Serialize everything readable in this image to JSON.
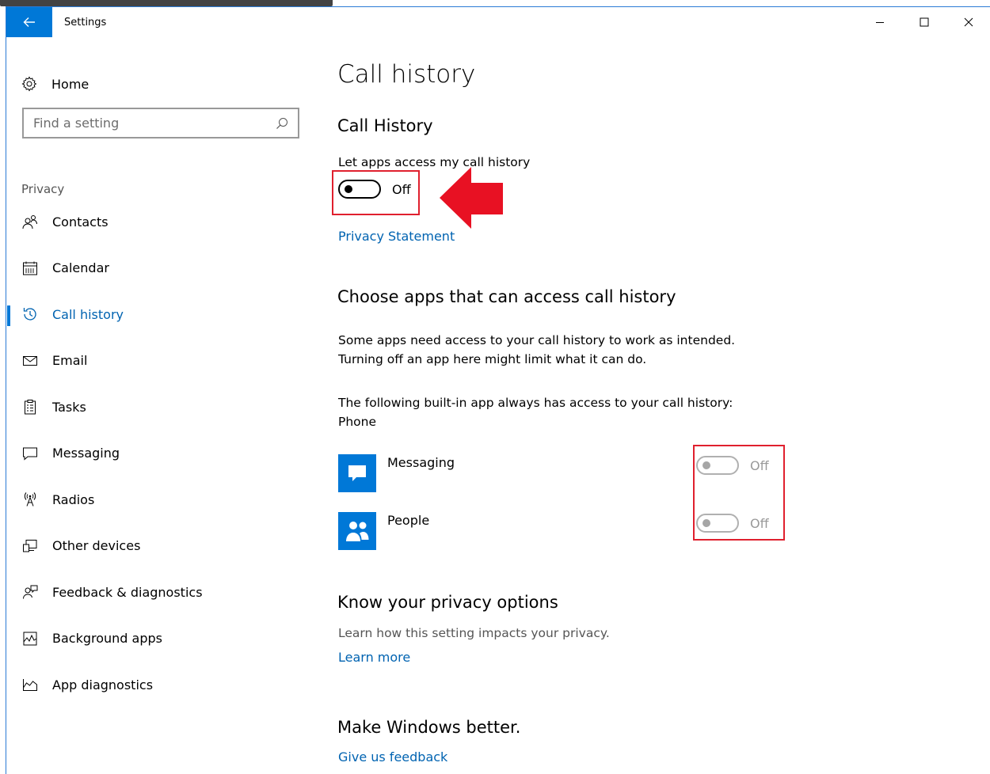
{
  "window": {
    "title": "Settings",
    "accent": "#0078d7",
    "controls": [
      "minimize-icon",
      "maximize-icon",
      "close-icon"
    ]
  },
  "sidebar": {
    "home_label": "Home",
    "search_placeholder": "Find a setting",
    "section_label": "Privacy",
    "items": [
      {
        "label": "Contacts",
        "icon": "contacts-icon"
      },
      {
        "label": "Calendar",
        "icon": "calendar-icon"
      },
      {
        "label": "Call history",
        "icon": "history-icon",
        "active": true
      },
      {
        "label": "Email",
        "icon": "email-icon"
      },
      {
        "label": "Tasks",
        "icon": "tasks-icon"
      },
      {
        "label": "Messaging",
        "icon": "messaging-icon"
      },
      {
        "label": "Radios",
        "icon": "radios-icon"
      },
      {
        "label": "Other devices",
        "icon": "other-devices-icon"
      },
      {
        "label": "Feedback & diagnostics",
        "icon": "feedback-icon"
      },
      {
        "label": "Background apps",
        "icon": "background-apps-icon"
      },
      {
        "label": "App diagnostics",
        "icon": "app-diagnostics-icon"
      }
    ]
  },
  "main": {
    "page_title": "Call history",
    "section1": {
      "heading": "Call History",
      "toggle_caption": "Let apps access my call history",
      "toggle_state": "Off",
      "privacy_link": "Privacy Statement"
    },
    "section2": {
      "heading": "Choose apps that can access call history",
      "desc_line1": "Some apps need access to your call history to work as intended.",
      "desc_line2": "Turning off an app here might limit what it can do.",
      "builtin_line1": "The following built-in app always has access to your call history:",
      "builtin_line2": "Phone",
      "apps": [
        {
          "name": "Messaging",
          "icon": "messaging-app-icon",
          "state": "Off"
        },
        {
          "name": "People",
          "icon": "people-app-icon",
          "state": "Off"
        }
      ]
    },
    "section3": {
      "heading": "Know your privacy options",
      "desc": "Learn how this setting impacts your privacy.",
      "link": "Learn more"
    },
    "section4": {
      "heading": "Make Windows better.",
      "link": "Give us feedback"
    }
  },
  "annotation_color": "#e0202e"
}
